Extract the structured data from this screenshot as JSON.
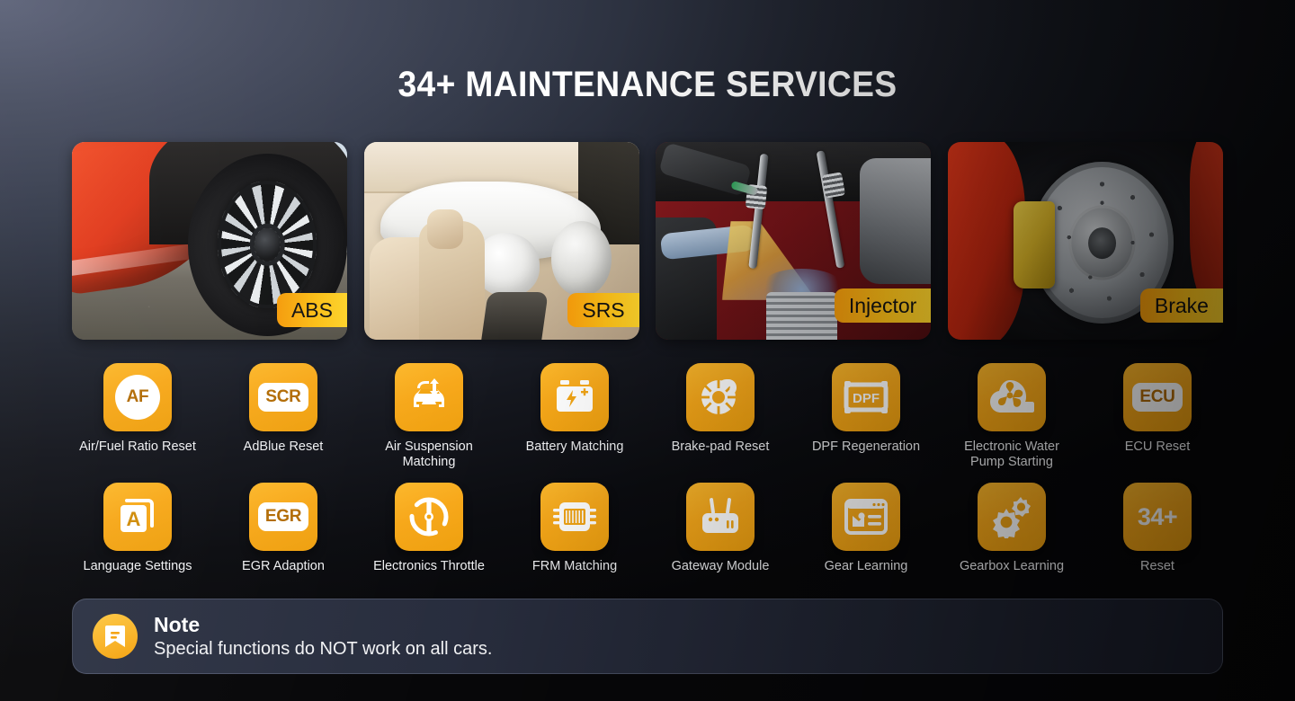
{
  "header": {
    "title": "34+ MAINTENANCE SERVICES"
  },
  "cards": [
    {
      "label": "ABS",
      "scene": "wheel-photo"
    },
    {
      "label": "SRS",
      "scene": "airbag-interior-photo"
    },
    {
      "label": "Injector",
      "scene": "engine-injector-photo"
    },
    {
      "label": "Brake",
      "scene": "brake-disc-photo"
    }
  ],
  "services": [
    {
      "label": "Air/Fuel Ratio Reset",
      "icon": "af-badge-icon",
      "badge": "AF"
    },
    {
      "label": "AdBlue Reset",
      "icon": "scr-badge-icon",
      "badge": "SCR"
    },
    {
      "label": "Air Suspension Matching",
      "icon": "car-suspension-icon",
      "badge": ""
    },
    {
      "label": "Battery Matching",
      "icon": "battery-icon",
      "badge": ""
    },
    {
      "label": "Brake-pad Reset",
      "icon": "brake-rotor-icon",
      "badge": ""
    },
    {
      "label": "DPF Regeneration",
      "icon": "dpf-badge-icon",
      "badge": "DPF"
    },
    {
      "label": "Electronic Water Pump Starting",
      "icon": "water-pump-icon",
      "badge": ""
    },
    {
      "label": "ECU Reset",
      "icon": "ecu-badge-icon",
      "badge": "ECU"
    },
    {
      "label": "Language Settings",
      "icon": "language-card-icon",
      "badge": "A"
    },
    {
      "label": "EGR Adaption",
      "icon": "egr-badge-icon",
      "badge": "EGR"
    },
    {
      "label": "Electronics Throttle",
      "icon": "throttle-body-icon",
      "badge": ""
    },
    {
      "label": "FRM Matching",
      "icon": "control-module-icon",
      "badge": ""
    },
    {
      "label": "Gateway Module",
      "icon": "gateway-router-icon",
      "badge": ""
    },
    {
      "label": "Gear Learning",
      "icon": "gear-window-icon",
      "badge": ""
    },
    {
      "label": "Gearbox Learning",
      "icon": "gears-icon",
      "badge": ""
    },
    {
      "label": "Reset",
      "icon": "count-badge-icon",
      "badge": "34+"
    }
  ],
  "note": {
    "icon": "note-bookmark-icon",
    "title": "Note",
    "body": "Special functions do NOT work on all cars."
  },
  "colors": {
    "accent": "#f7a81a",
    "accent_light": "#fdd32b",
    "badge_text": "#b26c05",
    "background_dark": "#0a0a0c",
    "background_light": "#5c6278",
    "note_panel": "#2f3547"
  }
}
